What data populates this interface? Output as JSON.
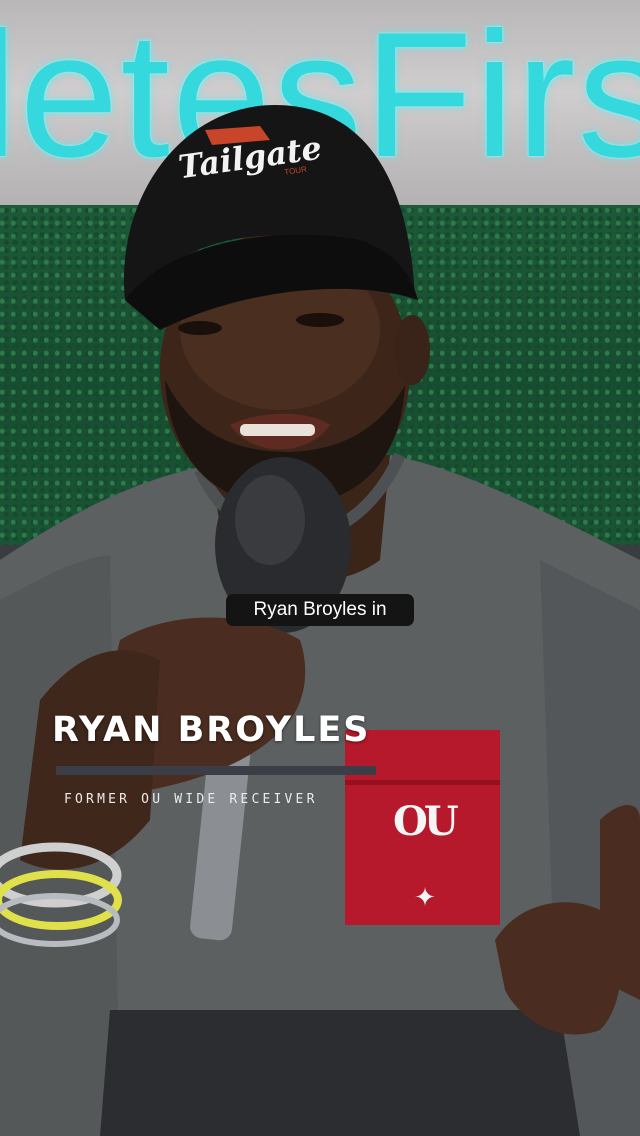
{
  "background_sign": {
    "text": "letesFirs"
  },
  "cap_logo": {
    "text": "Tailgate",
    "sub": "TOUR"
  },
  "jersey_pocket": {
    "logo": "OU"
  },
  "caption": {
    "text": "Ryan Broyles in"
  },
  "lower_third": {
    "name": "RYAN BROYLES",
    "subtitle": "FORMER OU WIDE RECEIVER"
  },
  "colors": {
    "sign_letters": "#35d8dc",
    "pocket_red": "#b5192b",
    "caption_bg": "#141414",
    "bar": "#3b3e46"
  }
}
